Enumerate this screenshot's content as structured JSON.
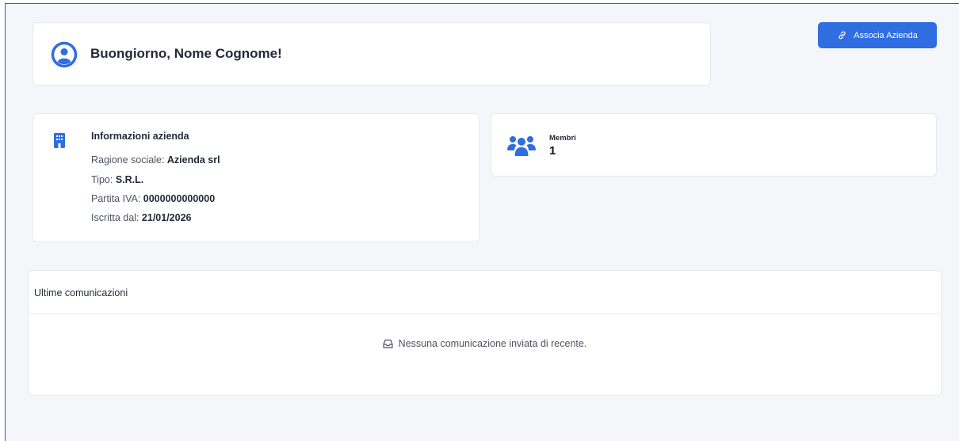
{
  "greeting": {
    "text": "Buongiorno, Nome Cognome!",
    "icon": "user-circle-icon"
  },
  "actions": {
    "associa_label": "Associa Azienda",
    "associa_icon": "link-icon"
  },
  "company": {
    "title": "Informazioni azienda",
    "icon": "building-icon",
    "ragione_label": "Ragione sociale:",
    "ragione_value": "Azienda srl",
    "tipo_label": "Tipo:",
    "tipo_value": "S.R.L.",
    "piva_label": "Partita IVA:",
    "piva_value": "0000000000000",
    "iscritta_label": "Iscritta dal:",
    "iscritta_value": "21/01/2026"
  },
  "members": {
    "label": "Membri",
    "count": "1",
    "icon": "users-icon"
  },
  "communications": {
    "title": "Ultime comunicazioni",
    "empty_text": "Nessuna comunicazione inviata di recente.",
    "empty_icon": "inbox-icon"
  },
  "colors": {
    "primary": "#2f6de1",
    "background": "#f4f6fa",
    "card": "#ffffff"
  }
}
